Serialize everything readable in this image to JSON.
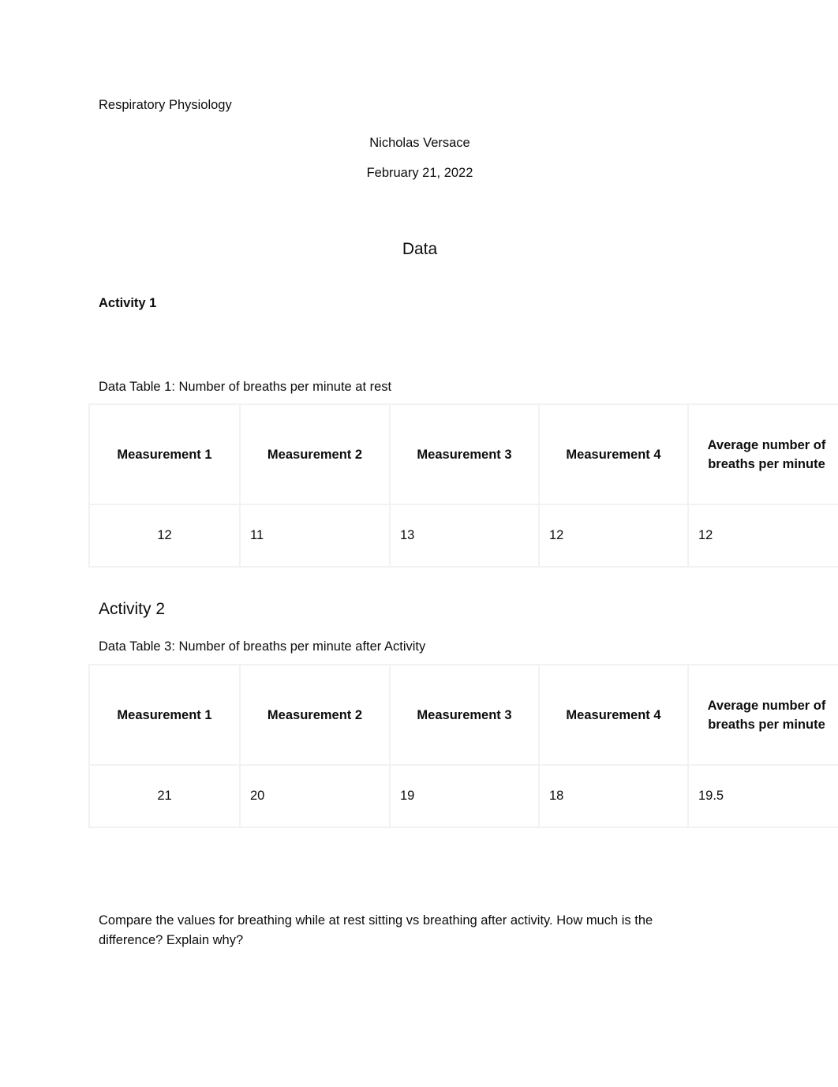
{
  "document": {
    "title": "Respiratory Physiology",
    "author": "Nicholas Versace",
    "date": "February 21, 2022",
    "section_heading": "Data"
  },
  "activity1": {
    "heading": "Activity 1",
    "table_caption": "Data Table 1: Number of breaths per minute at rest",
    "table": {
      "headers": [
        "Measurement 1",
        "Measurement 2",
        "Measurement 3",
        "Measurement 4",
        "Average number of breaths per minute"
      ],
      "rows": [
        [
          "12",
          "11",
          "13",
          "12",
          "12"
        ]
      ]
    }
  },
  "activity2": {
    "heading": "Activity 2",
    "table_caption": "Data Table 3: Number of breaths per minute after Activity",
    "table": {
      "headers": [
        "Measurement 1",
        "Measurement 2",
        "Measurement 3",
        "Measurement 4",
        "Average number of breaths per minute"
      ],
      "rows": [
        [
          "21",
          "20",
          "19",
          "18",
          "19.5"
        ]
      ]
    }
  },
  "closing": {
    "question": "Compare the values for breathing while at rest sitting vs breathing after activity. How much is the difference? Explain why?"
  },
  "colors": {
    "text": "#0d0d0d",
    "table_border": "#f2f2f2",
    "page_background": "#ffffff"
  }
}
